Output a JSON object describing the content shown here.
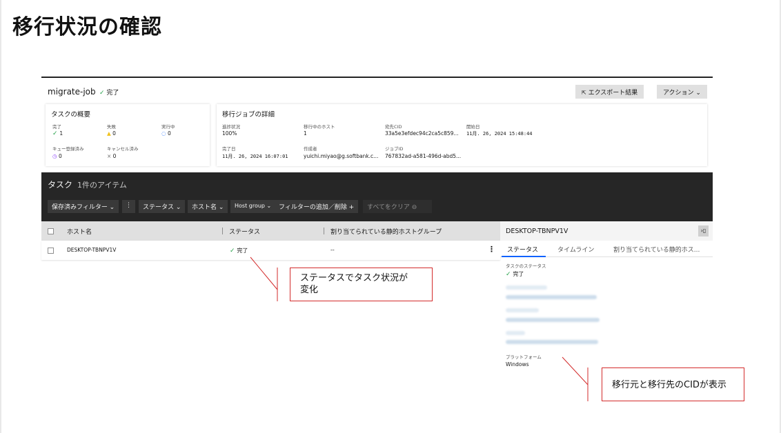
{
  "slide": {
    "title": "移行状況の確認"
  },
  "job": {
    "name": "migrate-job",
    "status": "完了",
    "export_button": "エクスポート結果",
    "action_button": "アクション ⌄"
  },
  "summary": {
    "title": "タスクの概要",
    "items": [
      {
        "label": "完了",
        "value": "1"
      },
      {
        "label": "失敗",
        "value": "0"
      },
      {
        "label": "実行中",
        "value": "0"
      },
      {
        "label": "キュー登録済み",
        "value": "0"
      },
      {
        "label": "キャンセル済み",
        "value": "0"
      }
    ]
  },
  "details": {
    "title": "移行ジョブの詳細",
    "items": [
      {
        "label": "進捗状況",
        "value": "100%"
      },
      {
        "label": "移行中のホスト",
        "value": "1"
      },
      {
        "label": "宛先CID",
        "value": "33a5e3efdec94c2ca5c859..."
      },
      {
        "label": "開始日",
        "value": "11月. 26, 2024 15:48:44"
      },
      {
        "label": "完了日",
        "value": "11月. 26, 2024 16:07:01"
      },
      {
        "label": "作成者",
        "value": "yuichi.miyao@g.softbank.c..."
      },
      {
        "label": "ジョブID",
        "value": "767832ad-a581-496d-abd5..."
      }
    ]
  },
  "tasks": {
    "title": "タスク",
    "count": "1件のアイテム",
    "filters": {
      "saved": "保存済みフィルター ⌄",
      "more": "⋮",
      "status": "ステータス ⌄",
      "hostname": "ホスト名 ⌄",
      "hostgroup": "Host group ⌄",
      "add": "フィルターの追加／削除 +",
      "clear": "すべてをクリア ⊖"
    },
    "columns": [
      "ホスト名",
      "ステータス",
      "割り当てられている静的ホストグループ"
    ],
    "rows": [
      {
        "host": "DESKTOP-TBNPV1V",
        "status": "完了",
        "group": "--",
        "menu": "⋮"
      }
    ]
  },
  "panel": {
    "title": "DESKTOP-TBNPV1V",
    "collapse": "›▯",
    "tabs": [
      "ステータス",
      "タイムライン",
      "割り当てられている静的ホス..."
    ],
    "task_status_label": "タスクのステータス",
    "task_status_value": "完了",
    "platform_label": "プラットフォーム",
    "platform_value": "Windows"
  },
  "callouts": {
    "status_change": [
      "ステータスでタスク状況が",
      "変化"
    ],
    "cid_display": "移行元と移行先のCIDが表示"
  },
  "colors": {
    "accent": "#0f62fe",
    "success": "#24a148",
    "warning": "#f1c21b",
    "queued": "#8a3ffc",
    "callout_border": "#d32a2a",
    "band": "#262626"
  }
}
